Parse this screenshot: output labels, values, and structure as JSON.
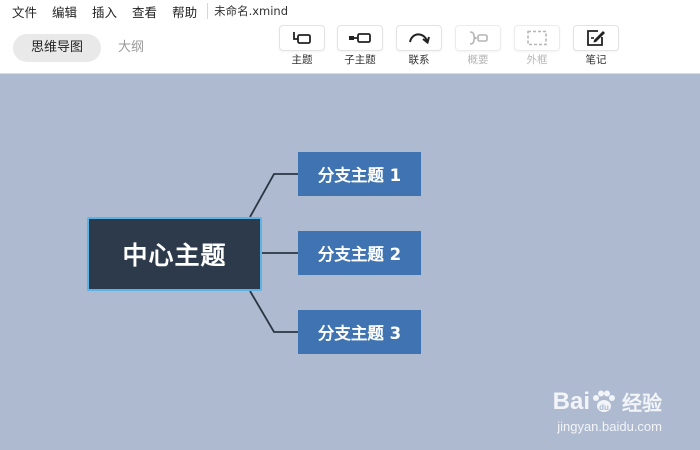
{
  "menubar": {
    "items": [
      "文件",
      "编辑",
      "插入",
      "查看",
      "帮助"
    ],
    "file_title": "未命名.xmind"
  },
  "toolbar": {
    "view_tabs": [
      {
        "label": "思维导图",
        "active": true
      },
      {
        "label": "大纲",
        "active": false
      }
    ],
    "tools": [
      {
        "label": "主题",
        "icon": "topic-icon",
        "enabled": true
      },
      {
        "label": "子主题",
        "icon": "subtopic-icon",
        "enabled": true
      },
      {
        "label": "联系",
        "icon": "relationship-icon",
        "enabled": true
      },
      {
        "label": "概要",
        "icon": "summary-icon",
        "enabled": false
      },
      {
        "label": "外框",
        "icon": "boundary-icon",
        "enabled": false
      },
      {
        "label": "笔记",
        "icon": "note-icon",
        "enabled": true
      }
    ]
  },
  "mindmap": {
    "central_topic": "中心主题",
    "branches": [
      "分支主题 1",
      "分支主题 2",
      "分支主题 3"
    ]
  },
  "watermark": {
    "logo_text": "Bai",
    "logo_tail": "经验",
    "url": "jingyan.baidu.com"
  },
  "colors": {
    "canvas_bg": "#adbad0",
    "central_bg": "#2d3a4b",
    "central_border": "#5db3e6",
    "branch_bg": "#3f73b1"
  }
}
